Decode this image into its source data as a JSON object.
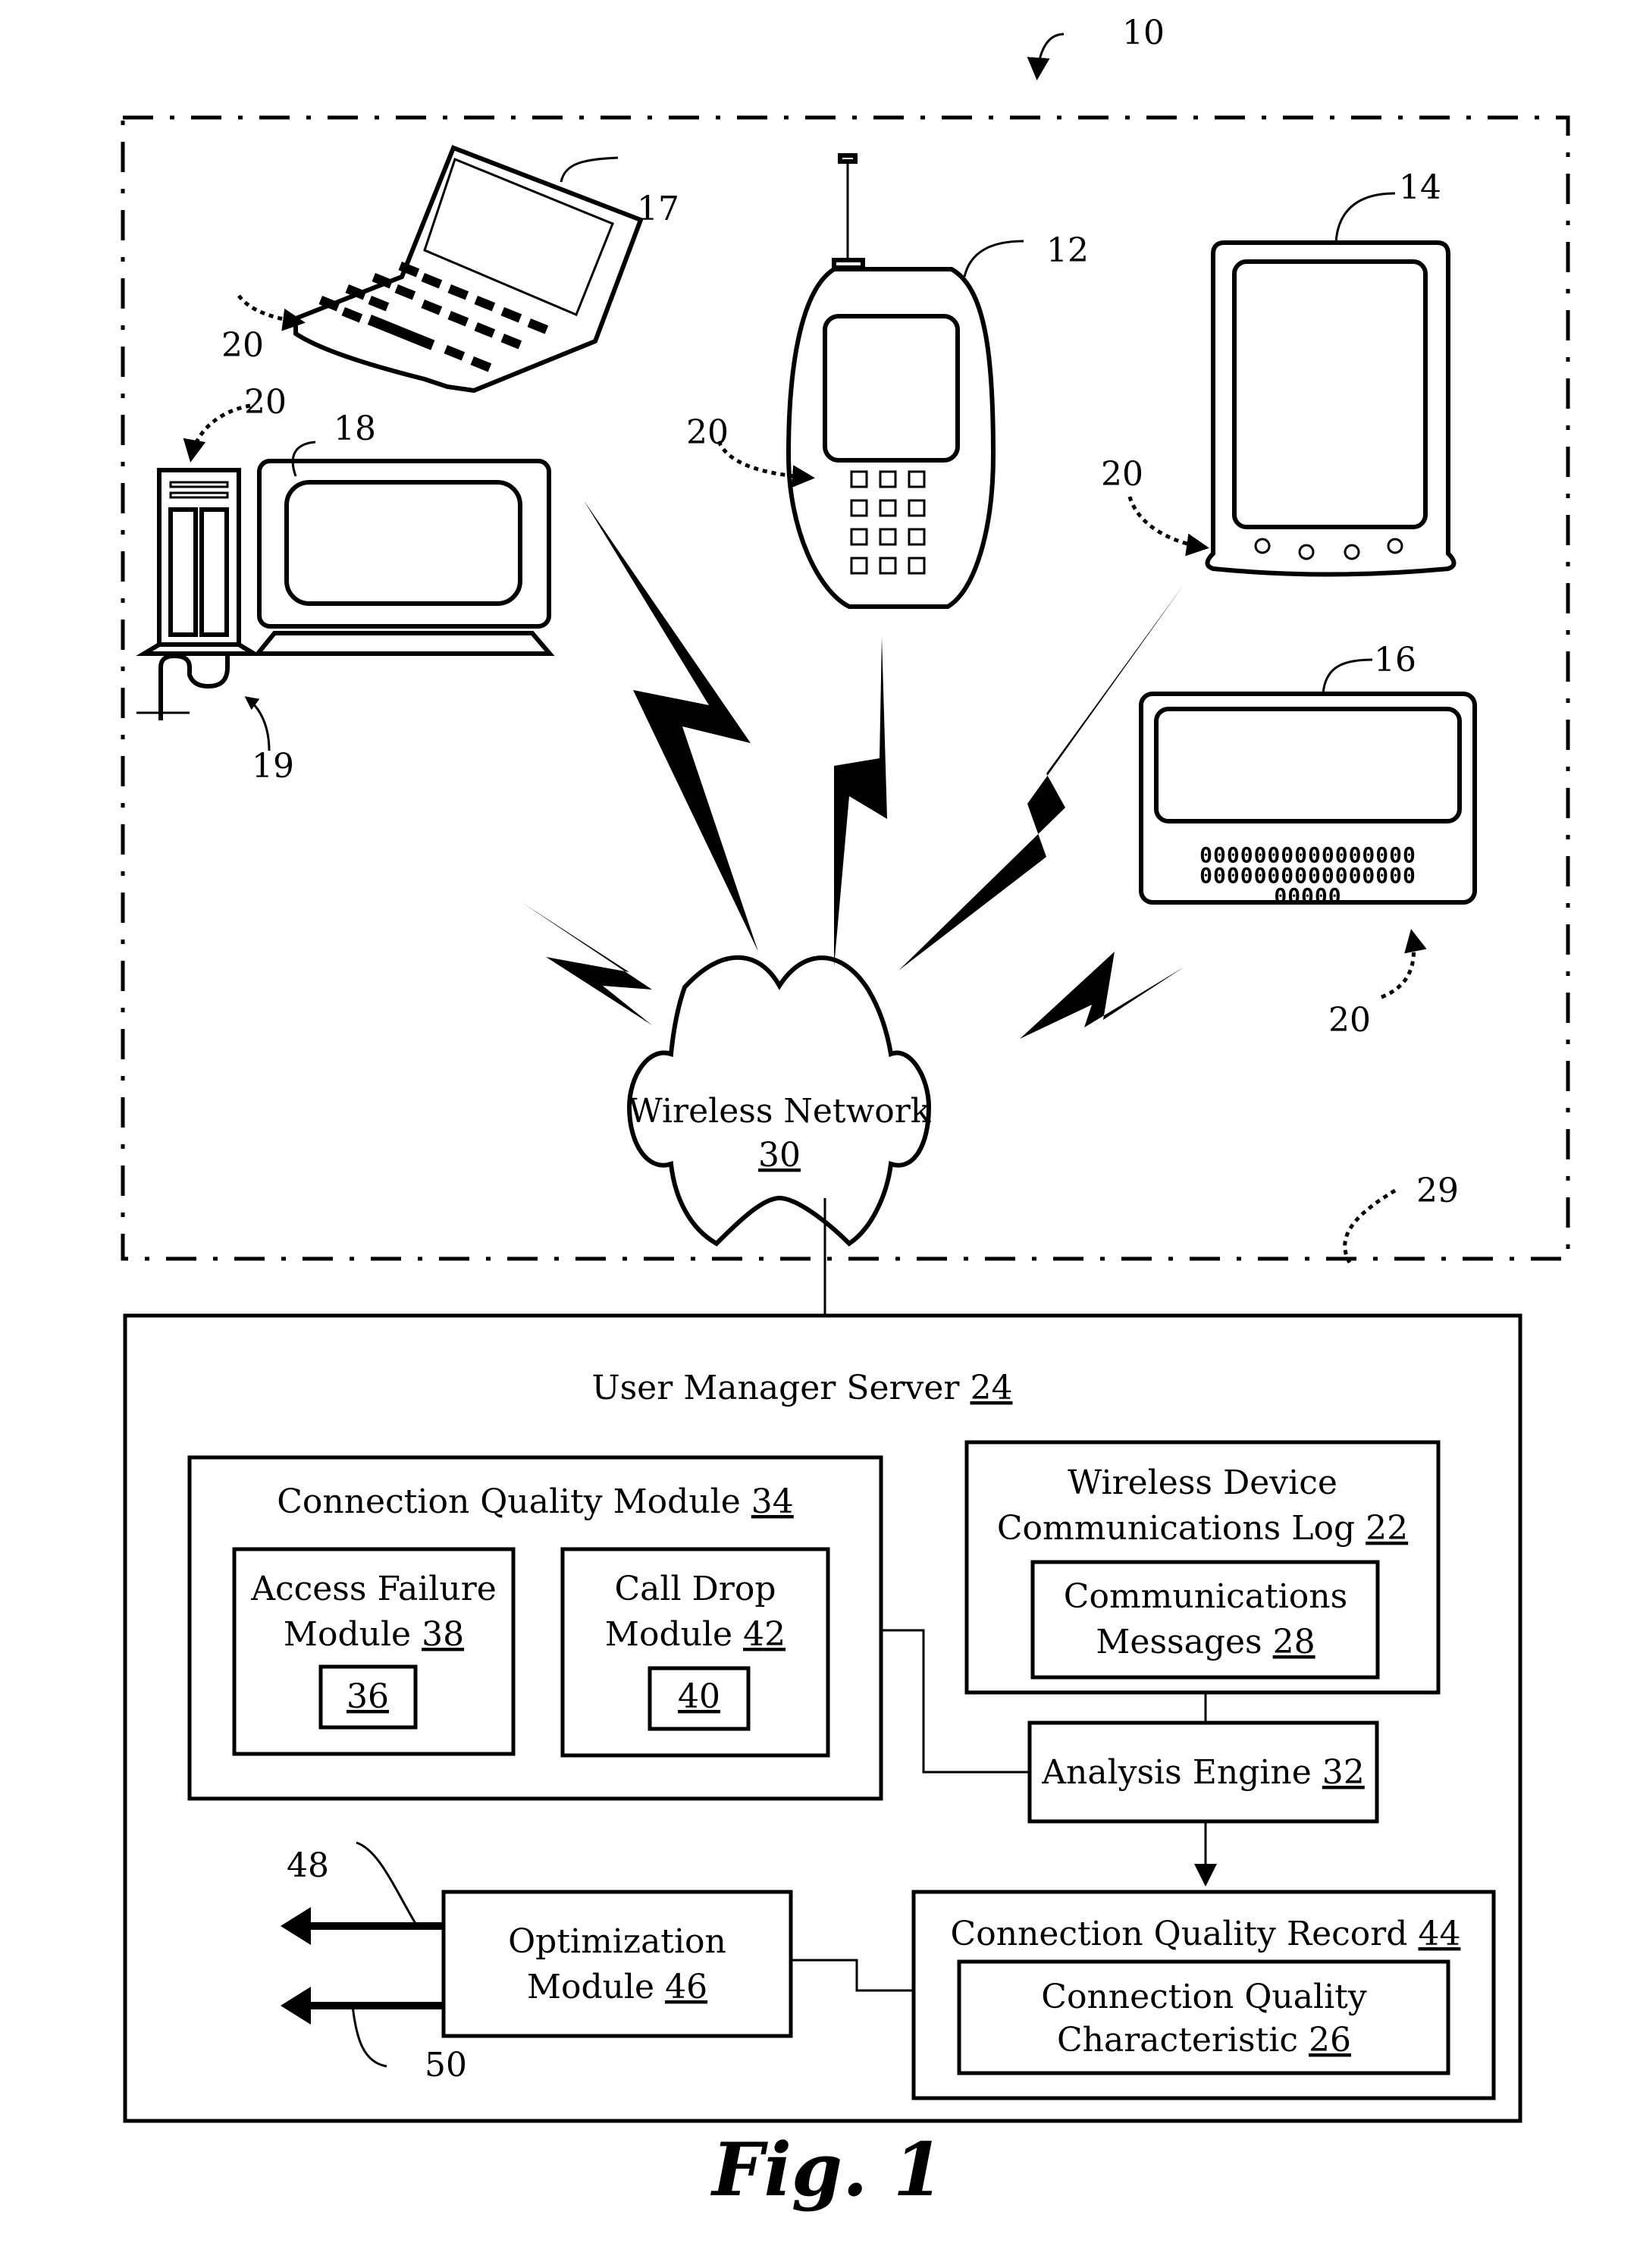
{
  "figure": {
    "caption": "Fig. 1",
    "system_ref": "10",
    "boundary_ref": "29"
  },
  "devices": [
    {
      "id": "laptop",
      "ref": "17",
      "agent_ref": "20"
    },
    {
      "id": "cell-phone",
      "ref": "12",
      "agent_ref": "20"
    },
    {
      "id": "pda",
      "ref": "14",
      "agent_ref": "20"
    },
    {
      "id": "desktop",
      "ref": "18",
      "agent_ref": "20",
      "connection_ref": "19"
    },
    {
      "id": "pager",
      "ref": "16",
      "agent_ref": "20",
      "keys_rows": [
        "0000000000000000",
        "0000000000000000",
        "00000"
      ]
    }
  ],
  "network": {
    "label": "Wireless Network",
    "ref": "30"
  },
  "server": {
    "label": "User Manager Server",
    "ref": "24",
    "connection_quality_module": {
      "label": "Connection Quality Module",
      "ref": "34"
    },
    "access_failure_module": {
      "line1": "Access Failure",
      "line2": "Module",
      "ref": "38",
      "inner_ref": "36"
    },
    "call_drop_module": {
      "line1": "Call Drop",
      "line2": "Module",
      "ref": "42",
      "inner_ref": "40"
    },
    "comm_log": {
      "line1": "Wireless Device",
      "line2": "Communications Log",
      "ref": "22"
    },
    "comm_messages": {
      "line1": "Communications",
      "line2": "Messages",
      "ref": "28"
    },
    "analysis_engine": {
      "label": "Analysis Engine",
      "ref": "32"
    },
    "optimization_module": {
      "line1": "Optimization",
      "line2": "Module",
      "ref": "46"
    },
    "cq_record": {
      "label": "Connection Quality Record",
      "ref": "44"
    },
    "cq_characteristic": {
      "line1": "Connection Quality",
      "line2": "Characteristic",
      "ref": "26"
    },
    "outputs": [
      {
        "ref": "48"
      },
      {
        "ref": "50"
      }
    ]
  }
}
